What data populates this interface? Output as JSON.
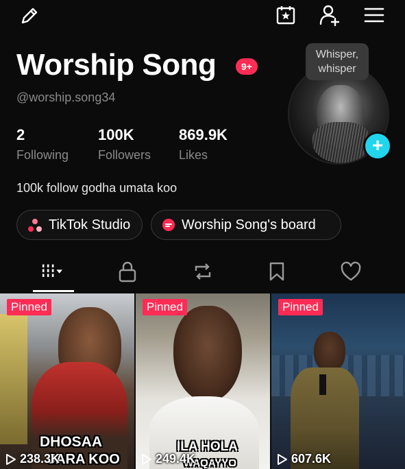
{
  "topbar": {
    "left_icon": "pencil-icon",
    "right_icons": [
      "calendar-star-icon",
      "add-friend-icon",
      "menu-icon"
    ]
  },
  "profile": {
    "name": "Worship Song",
    "notification_badge": "9+",
    "handle": "@worship.song34",
    "avatar_bubble": "Whisper, whisper",
    "add_button_icon": "plus-icon",
    "stats": [
      {
        "value": "2",
        "label": "Following"
      },
      {
        "value": "100K",
        "label": "Followers"
      },
      {
        "value": "869.9K",
        "label": "Likes"
      }
    ],
    "bio": "100k follow godha umata koo"
  },
  "pills": [
    {
      "label": "TikTok Studio",
      "icon": "studio-icon"
    },
    {
      "label": "Worship Song's board",
      "icon": "board-icon"
    }
  ],
  "tabs": [
    {
      "icon": "grid-icon",
      "active": true
    },
    {
      "icon": "lock-icon",
      "active": false
    },
    {
      "icon": "repost-icon",
      "active": false
    },
    {
      "icon": "bookmark-icon",
      "active": false
    },
    {
      "icon": "heart-icon",
      "active": false
    }
  ],
  "videos": [
    {
      "pinned_label": "Pinned",
      "views": "238.3K",
      "caption_line1": "DHOSAA",
      "caption_line2": "JARA KOO"
    },
    {
      "pinned_label": "Pinned",
      "views": "249.4K",
      "caption_line1": "ILA HOLA",
      "caption_line2": "WAQAYYO"
    },
    {
      "pinned_label": "Pinned",
      "views": "607.6K",
      "caption_line1": "",
      "caption_line2": ""
    }
  ],
  "colors": {
    "background": "#0b0b0b",
    "accent_red": "#fe2c55",
    "accent_cyan": "#20d5ec",
    "muted_text": "#8a8a8a"
  }
}
